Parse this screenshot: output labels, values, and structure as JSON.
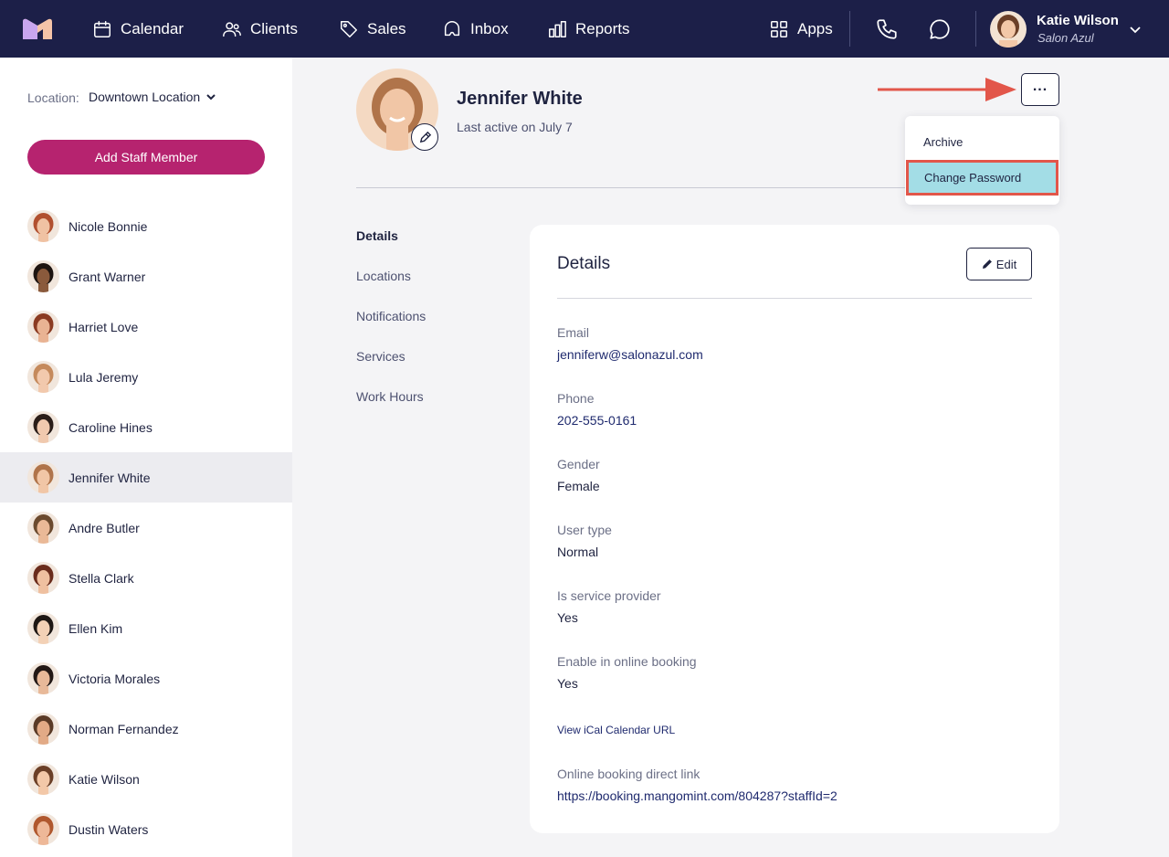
{
  "nav": {
    "items": [
      {
        "label": "Calendar",
        "icon": "calendar-icon"
      },
      {
        "label": "Clients",
        "icon": "clients-icon"
      },
      {
        "label": "Sales",
        "icon": "tag-icon"
      },
      {
        "label": "Inbox",
        "icon": "inbox-icon"
      },
      {
        "label": "Reports",
        "icon": "reports-icon"
      }
    ],
    "apps_label": "Apps",
    "user": {
      "name": "Katie Wilson",
      "salon": "Salon Azul"
    }
  },
  "sidebar": {
    "location_label": "Location:",
    "location_value": "Downtown Location",
    "add_button": "Add Staff Member",
    "staff": [
      {
        "name": "Nicole Bonnie",
        "skin": "#f0c2a3",
        "hair": "#b1502f"
      },
      {
        "name": "Grant Warner",
        "skin": "#8a5a3c",
        "hair": "#1d1410"
      },
      {
        "name": "Harriet Love",
        "skin": "#e9b393",
        "hair": "#8b3b22"
      },
      {
        "name": "Lula Jeremy",
        "skin": "#f2c9ad",
        "hair": "#c58a5c"
      },
      {
        "name": "Caroline Hines",
        "skin": "#f0c9ae",
        "hair": "#2a1d18"
      },
      {
        "name": "Jennifer White",
        "skin": "#f1c6a6",
        "hair": "#b0744a"
      },
      {
        "name": "Andre Butler",
        "skin": "#eab997",
        "hair": "#6b4a2e"
      },
      {
        "name": "Stella Clark",
        "skin": "#efc0a0",
        "hair": "#6a2c1c"
      },
      {
        "name": "Ellen Kim",
        "skin": "#f3d1b6",
        "hair": "#1e1714"
      },
      {
        "name": "Victoria Morales",
        "skin": "#e8b999",
        "hair": "#231815"
      },
      {
        "name": "Norman Fernandez",
        "skin": "#e2aa86",
        "hair": "#5a3a26"
      },
      {
        "name": "Katie Wilson",
        "skin": "#f3c8a8",
        "hair": "#6b3f27"
      },
      {
        "name": "Dustin Waters",
        "skin": "#eeb898",
        "hair": "#b0582e"
      }
    ],
    "active_index": 5
  },
  "profile": {
    "name": "Jennifer White",
    "last_active": "Last active on July 7"
  },
  "menu": {
    "archive": "Archive",
    "change_password": "Change Password"
  },
  "subnav": [
    "Details",
    "Locations",
    "Notifications",
    "Services",
    "Work Hours"
  ],
  "details": {
    "title": "Details",
    "edit_label": "Edit",
    "email_label": "Email",
    "email": "jenniferw@salonazul.com",
    "phone_label": "Phone",
    "phone": "202-555-0161",
    "gender_label": "Gender",
    "gender": "Female",
    "user_type_label": "User type",
    "user_type": "Normal",
    "service_provider_label": "Is service provider",
    "service_provider": "Yes",
    "online_booking_label": "Enable in online booking",
    "online_booking": "Yes",
    "ical_link": "View iCal Calendar URL",
    "booking_link_label": "Online booking direct link",
    "booking_link": "https://booking.mangomint.com/804287?staffId=2"
  },
  "colors": {
    "nav_bg": "#1c1f48",
    "accent": "#b6236f",
    "highlight": "#a3dde6",
    "annotation": "#e2564a"
  }
}
